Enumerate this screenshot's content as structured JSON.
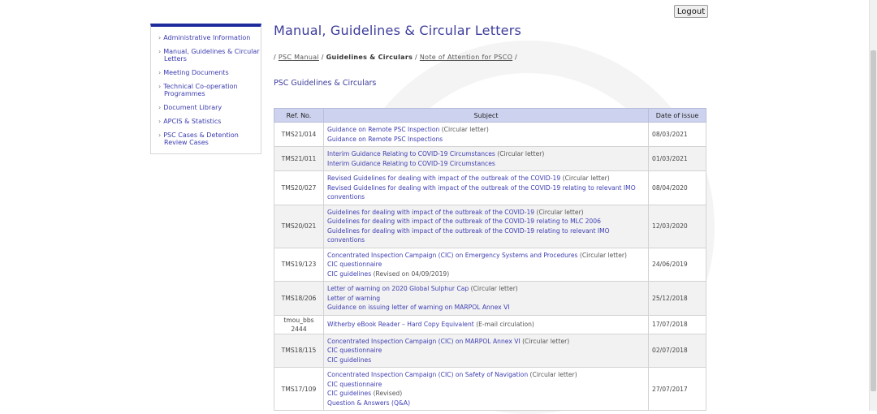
{
  "header": {
    "logout_label": "Logout"
  },
  "sidebar": {
    "items": [
      {
        "label": "Administrative Information"
      },
      {
        "label": "Manual, Guidelines & Circular Letters"
      },
      {
        "label": "Meeting Documents"
      },
      {
        "label": "Technical Co-operation Programmes"
      },
      {
        "label": "Document Library"
      },
      {
        "label": "APCIS & Statistics"
      },
      {
        "label": "PSC Cases & Detention Review Cases"
      }
    ]
  },
  "main": {
    "title": "Manual, Guidelines & Circular Letters",
    "breadcrumb": {
      "sep": "/",
      "psc_manual": "PSC Manual",
      "current": "Guidelines & Circulars",
      "note_psco": "Note of Attention for PSCO"
    },
    "section_title": "PSC Guidelines & Circulars",
    "table": {
      "headers": {
        "ref": "Ref. No.",
        "subject": "Subject",
        "date": "Date of issue"
      },
      "rows": [
        {
          "ref": "TMS21/014",
          "date": "08/03/2021",
          "lines": [
            {
              "link": "Guidance on Remote PSC Inspection",
              "note": " (Circular letter)"
            },
            {
              "link": "Guidance on Remote PSC Inspections",
              "note": ""
            }
          ]
        },
        {
          "ref": "TMS21/011",
          "date": "01/03/2021",
          "lines": [
            {
              "link": "Interim Guidance Relating to COVID-19 Circumstances",
              "note": " (Circular letter)"
            },
            {
              "link": "Interim Guidance Relating to COVID-19 Circumstances",
              "note": ""
            }
          ]
        },
        {
          "ref": "TMS20/027",
          "date": "08/04/2020",
          "lines": [
            {
              "link": "Revised Guidelines for dealing with impact of the outbreak of the COVID-19",
              "note": " (Circular letter)"
            },
            {
              "link": "Revised Guidelines for dealing with impact of the outbreak of the COVID-19 relating to relevant IMO conventions",
              "note": ""
            }
          ]
        },
        {
          "ref": "TMS20/021",
          "date": "12/03/2020",
          "lines": [
            {
              "link": "Guidelines for dealing with impact of the outbreak of the COVID-19",
              "note": " (Circular letter)"
            },
            {
              "link": "Guidelines for dealing with impact of the outbreak of the COVID-19 relating to MLC 2006",
              "note": ""
            },
            {
              "link": "Guidelines for dealing with impact of the outbreak of the COVID-19 relating to relevant IMO conventions",
              "note": ""
            }
          ]
        },
        {
          "ref": "TMS19/123",
          "date": "24/06/2019",
          "lines": [
            {
              "link": "Concentrated Inspection Campaign (CIC) on Emergency Systems and Procedures",
              "note": " (Circular letter)"
            },
            {
              "link": "CIC questionnaire",
              "note": ""
            },
            {
              "link": "CIC guidelines",
              "note": " (Revised on 04/09/2019)"
            }
          ]
        },
        {
          "ref": "TMS18/206",
          "date": "25/12/2018",
          "lines": [
            {
              "link": "Letter of warning on 2020 Global Sulphur Cap",
              "note": " (Circular letter)"
            },
            {
              "link": "Letter of warning",
              "note": ""
            },
            {
              "link": "Guidance on issuing letter of warning on MARPOL Annex VI",
              "note": ""
            }
          ]
        },
        {
          "ref": "tmou_bbs 2444",
          "date": "17/07/2018",
          "lines": [
            {
              "link": "Witherby eBook Reader – Hard Copy Equivalent",
              "note": " (E-mail circulation)"
            }
          ]
        },
        {
          "ref": "TMS18/115",
          "date": "02/07/2018",
          "lines": [
            {
              "link": "Concentrated Inspection Campaign (CIC) on MARPOL Annex VI",
              "note": " (Circular letter)"
            },
            {
              "link": "CIC questionnaire",
              "note": ""
            },
            {
              "link": "CIC guidelines",
              "note": ""
            }
          ]
        },
        {
          "ref": "TMS17/109",
          "date": "27/07/2017",
          "lines": [
            {
              "link": "Concentrated Inspection Campaign (CIC) on Safety of Navigation",
              "note": " (Circular letter)"
            },
            {
              "link": "CIC questionnaire",
              "note": ""
            },
            {
              "link": "CIC guidelines",
              "note": " (Revised)"
            },
            {
              "link": "Question & Answers (Q&A)",
              "note": ""
            }
          ]
        }
      ]
    }
  },
  "colors": {
    "accent": "#1e2b9c",
    "link": "#3e3eb3",
    "title": "#3d3d9c",
    "header_bg": "#cdd3ee"
  }
}
